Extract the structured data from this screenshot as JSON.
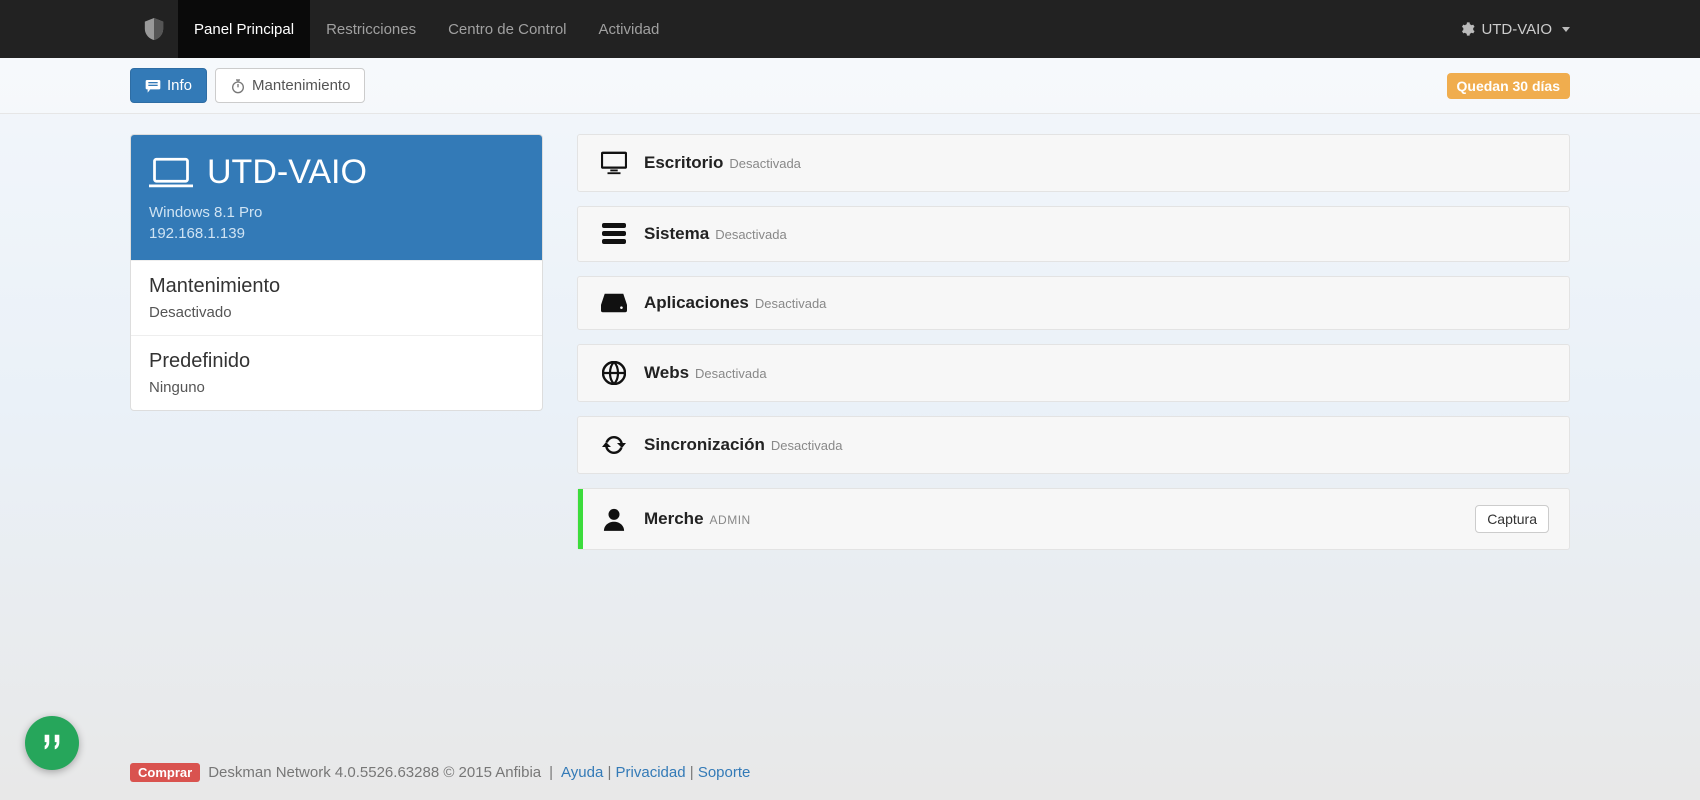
{
  "nav": {
    "items": [
      "Panel Principal",
      "Restricciones",
      "Centro de Control",
      "Actividad"
    ],
    "activeIndex": 0,
    "account": "UTD-VAIO"
  },
  "subbar": {
    "info": "Info",
    "maintenance": "Mantenimiento",
    "trial": "Quedan 30 días"
  },
  "device": {
    "name": "UTD-VAIO",
    "os": "Windows 8.1 Pro",
    "ip": "192.168.1.139",
    "rows": [
      {
        "title": "Mantenimiento",
        "sub": "Desactivado"
      },
      {
        "title": "Predefinido",
        "sub": "Ninguno"
      }
    ]
  },
  "features": [
    {
      "icon": "monitor",
      "title": "Escritorio",
      "status": "Desactivada"
    },
    {
      "icon": "server",
      "title": "Sistema",
      "status": "Desactivada"
    },
    {
      "icon": "hdd",
      "title": "Aplicaciones",
      "status": "Desactivada"
    },
    {
      "icon": "globe",
      "title": "Webs",
      "status": "Desactivada"
    },
    {
      "icon": "sync",
      "title": "Sincronización",
      "status": "Desactivada"
    },
    {
      "icon": "user",
      "title": "Merche",
      "sub": "ADMIN",
      "stripe": true,
      "button": "Captura"
    }
  ],
  "footer": {
    "buy": "Comprar",
    "text": "Deskman Network 4.0.5526.63288 © 2015 Anfibia",
    "links": [
      "Ayuda",
      "Privacidad",
      "Soporte"
    ]
  }
}
